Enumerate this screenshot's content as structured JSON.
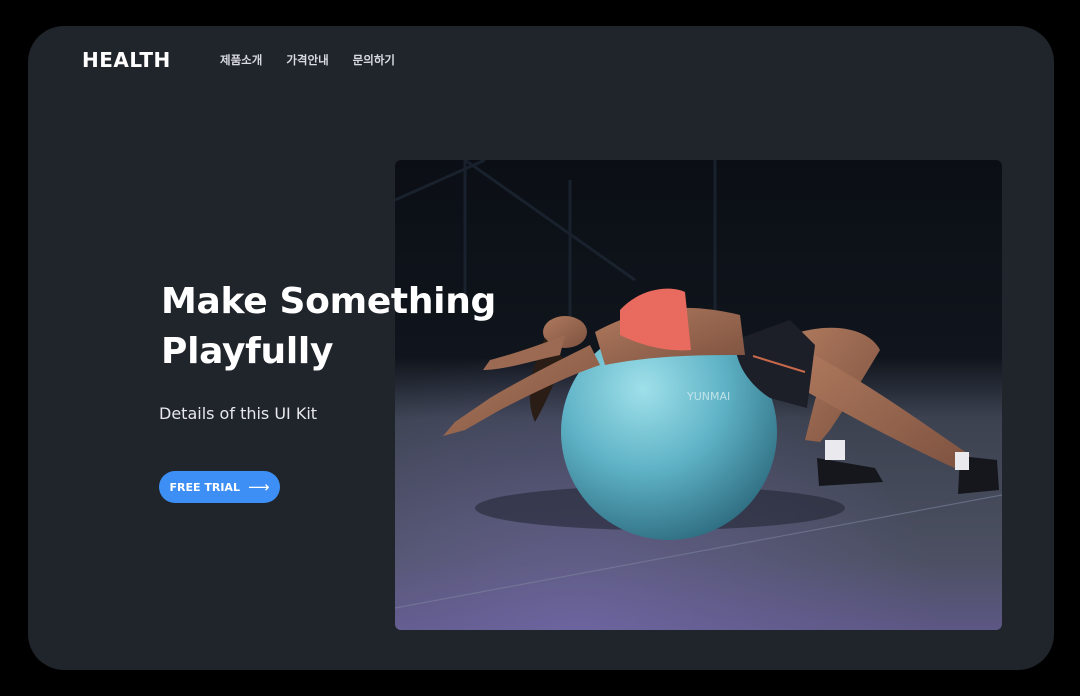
{
  "header": {
    "logo": "HEALTH",
    "nav": [
      {
        "label": "제품소개"
      },
      {
        "label": "가격안내"
      },
      {
        "label": "문의하기"
      }
    ]
  },
  "hero": {
    "title_line1": "Make Something",
    "title_line2": "Playfully",
    "subtitle": "Details of this UI Kit",
    "cta_label": "FREE TRIAL",
    "cta_icon": "arrow-right-icon",
    "cta_icon_glyph": "⟶",
    "image_label": "YUNMAI"
  },
  "colors": {
    "background": "#000000",
    "screen": "#20242b",
    "accent": "#3d8ff5",
    "text": "#ffffff"
  }
}
